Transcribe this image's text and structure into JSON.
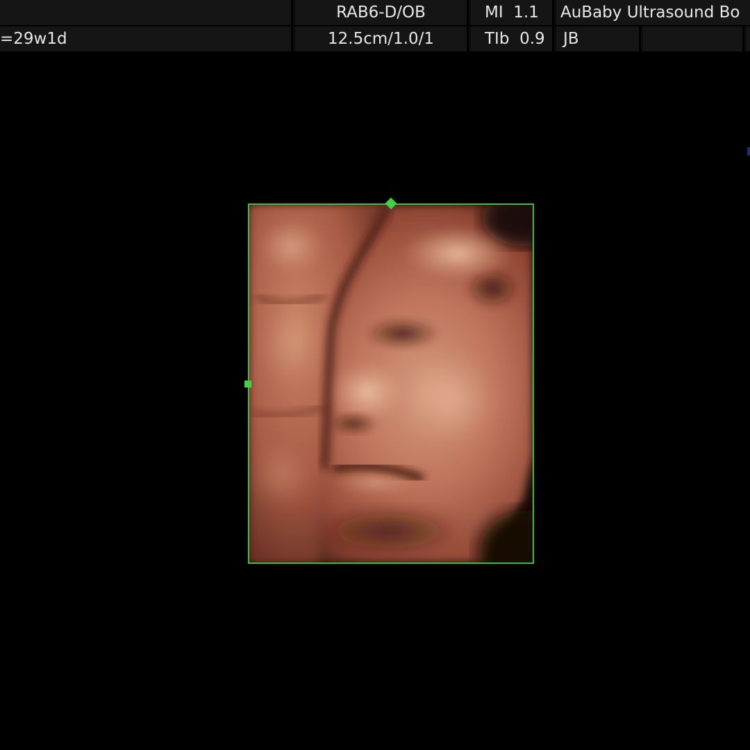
{
  "header": {
    "row1": {
      "probe_preset": "RAB6-D/OB",
      "mi_label": "MI",
      "mi_value": "1.1",
      "institution": "AuBaby Ultrasound Bo"
    },
    "row2": {
      "gestational_age": "=29w1d",
      "depth_settings": "12.5cm/1.0/1",
      "tib_label": "TIb",
      "tib_value": "0.9",
      "operator": "JB"
    }
  },
  "render": {
    "mode": "3D/4D surface render",
    "frame_color": "#3fbf3f",
    "tissue_color": "#b8664c"
  }
}
